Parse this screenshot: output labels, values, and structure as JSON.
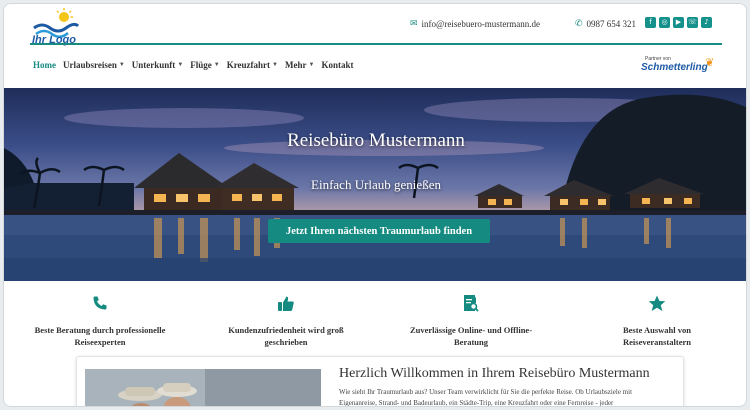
{
  "header": {
    "logo_text": "Ihr Logo",
    "email": "info@reisebuero-mustermann.de",
    "phone": "0987 654 321",
    "social_icons": [
      "facebook-icon",
      "instagram-icon",
      "youtube-icon",
      "whatsapp-icon",
      "tiktok-icon"
    ],
    "partner_small": "Partner von",
    "partner_name": "Schmetterling"
  },
  "nav": {
    "items": [
      {
        "label": "Home",
        "dropdown": false,
        "active": true
      },
      {
        "label": "Urlaubsreisen",
        "dropdown": true,
        "active": false
      },
      {
        "label": "Unterkunft",
        "dropdown": true,
        "active": false
      },
      {
        "label": "Flüge",
        "dropdown": true,
        "active": false
      },
      {
        "label": "Kreuzfahrt",
        "dropdown": true,
        "active": false
      },
      {
        "label": "Mehr",
        "dropdown": true,
        "active": false
      },
      {
        "label": "Kontakt",
        "dropdown": false,
        "active": false
      }
    ]
  },
  "hero": {
    "title": "Reisebüro Mustermann",
    "subtitle": "Einfach Urlaub genießen",
    "cta": "Jetzt Ihren nächsten Traumurlaub finden"
  },
  "features": [
    {
      "icon": "phone-icon",
      "line1": "Beste Beratung durch professionelle",
      "line2": "Reiseexperten"
    },
    {
      "icon": "thumbs-up-icon",
      "line1": "Kundenzufriedenheit wird groß",
      "line2": "geschrieben"
    },
    {
      "icon": "document-search-icon",
      "line1": "Zuverlässige Online- und Offline-",
      "line2": "Beratung"
    },
    {
      "icon": "star-icon",
      "line1": "Beste Auswahl von",
      "line2": "Reiseveranstaltern"
    }
  ],
  "welcome": {
    "title": "Herzlich Willkommen in Ihrem Reisebüro Mustermann",
    "text_line1": "Wie sieht Ihr Traumurlaub aus? Unser Team verwirklicht für Sie die perfekte Reise. Ob Urlaubsziele mit",
    "text_line2": "Eigenanreise, Strand- und Badeurlaub, ein Städte-Trip, eine Kreuzfahrt oder eine Fernreise - jeder"
  },
  "colors": {
    "accent": "#148a80",
    "logo_blue": "#1d5aa6",
    "butterfly_orange": "#f29417"
  }
}
